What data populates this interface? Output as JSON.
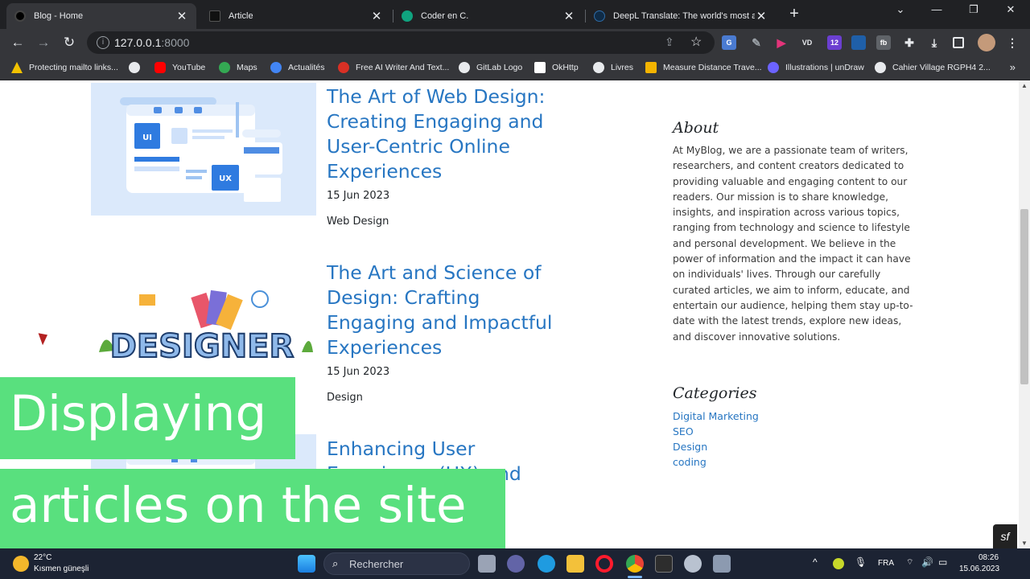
{
  "tabs": [
    {
      "title": "Blog - Home",
      "active": true
    },
    {
      "title": "Article",
      "active": false
    },
    {
      "title": "Coder en C.",
      "active": false
    },
    {
      "title": "DeepL Translate: The world's most accu",
      "active": false
    }
  ],
  "toolbar": {
    "url_host": "127.0.0.1",
    "url_port": ":8000",
    "extensions": [
      "google-translate",
      "pen-tool",
      "vidiq",
      "vd",
      "counter-12",
      "bitwarden",
      "fb",
      "puzzle",
      "download",
      "sidebar",
      "profile",
      "menu"
    ],
    "ext_badge": "12"
  },
  "bookmarks": [
    "Protecting mailto links...",
    "",
    "YouTube",
    "Maps",
    "Actualités",
    "Free AI Writer And Text...",
    "GitLab Logo",
    "OkHttp",
    "Livres",
    "Measure Distance Trave...",
    "Illustrations | unDraw",
    "Cahier Village RGPH4 2..."
  ],
  "articles": [
    {
      "title": "The Art of Web Design: Creating Engaging and User-Centric Online Experiences",
      "date": "15 Jun 2023",
      "category": "Web Design",
      "image": "ui-ux-illustration"
    },
    {
      "title": "The Art and Science of Design: Crafting Engaging and Impactful Experiences",
      "date": "15 Jun 2023",
      "category": "Design",
      "image": "designer-illustration",
      "image_text": "DESIGNER"
    },
    {
      "title": "Enhancing User Experience (UX) and",
      "date": "",
      "category": "",
      "image": "ui-ux-illustration"
    }
  ],
  "thumb_labels": {
    "ui": "UI",
    "ux": "UX"
  },
  "sidebar": {
    "about_heading": "About",
    "about_text": "At MyBlog, we are a passionate team of writers, researchers, and content creators dedicated to providing valuable and engaging content to our readers. Our mission is to share knowledge, insights, and inspiration across various topics, ranging from technology and science to lifestyle and personal development. We believe in the power of information and the impact it can have on individuals' lives. Through our carefully curated articles, we aim to inform, educate, and entertain our audience, helping them stay up-to-date with the latest trends, explore new ideas, and discover innovative solutions.",
    "categories_heading": "Categories",
    "categories": [
      "Digital Marketing",
      "SEO",
      "Design",
      "coding"
    ]
  },
  "captions": [
    "Displaying",
    "articles on the site"
  ],
  "taskbar": {
    "weather_temp": "22°C",
    "weather_desc": "Kısmen güneşli",
    "search_label": "Rechercher",
    "lang": "FRA",
    "time": "08:26",
    "date": "15.06.2023"
  },
  "colors": {
    "link": "#2776c2",
    "caption_bg": "#59e07e",
    "chrome_dark": "#202124",
    "chrome_mid": "#35363a",
    "taskbar": "#1c2333"
  }
}
